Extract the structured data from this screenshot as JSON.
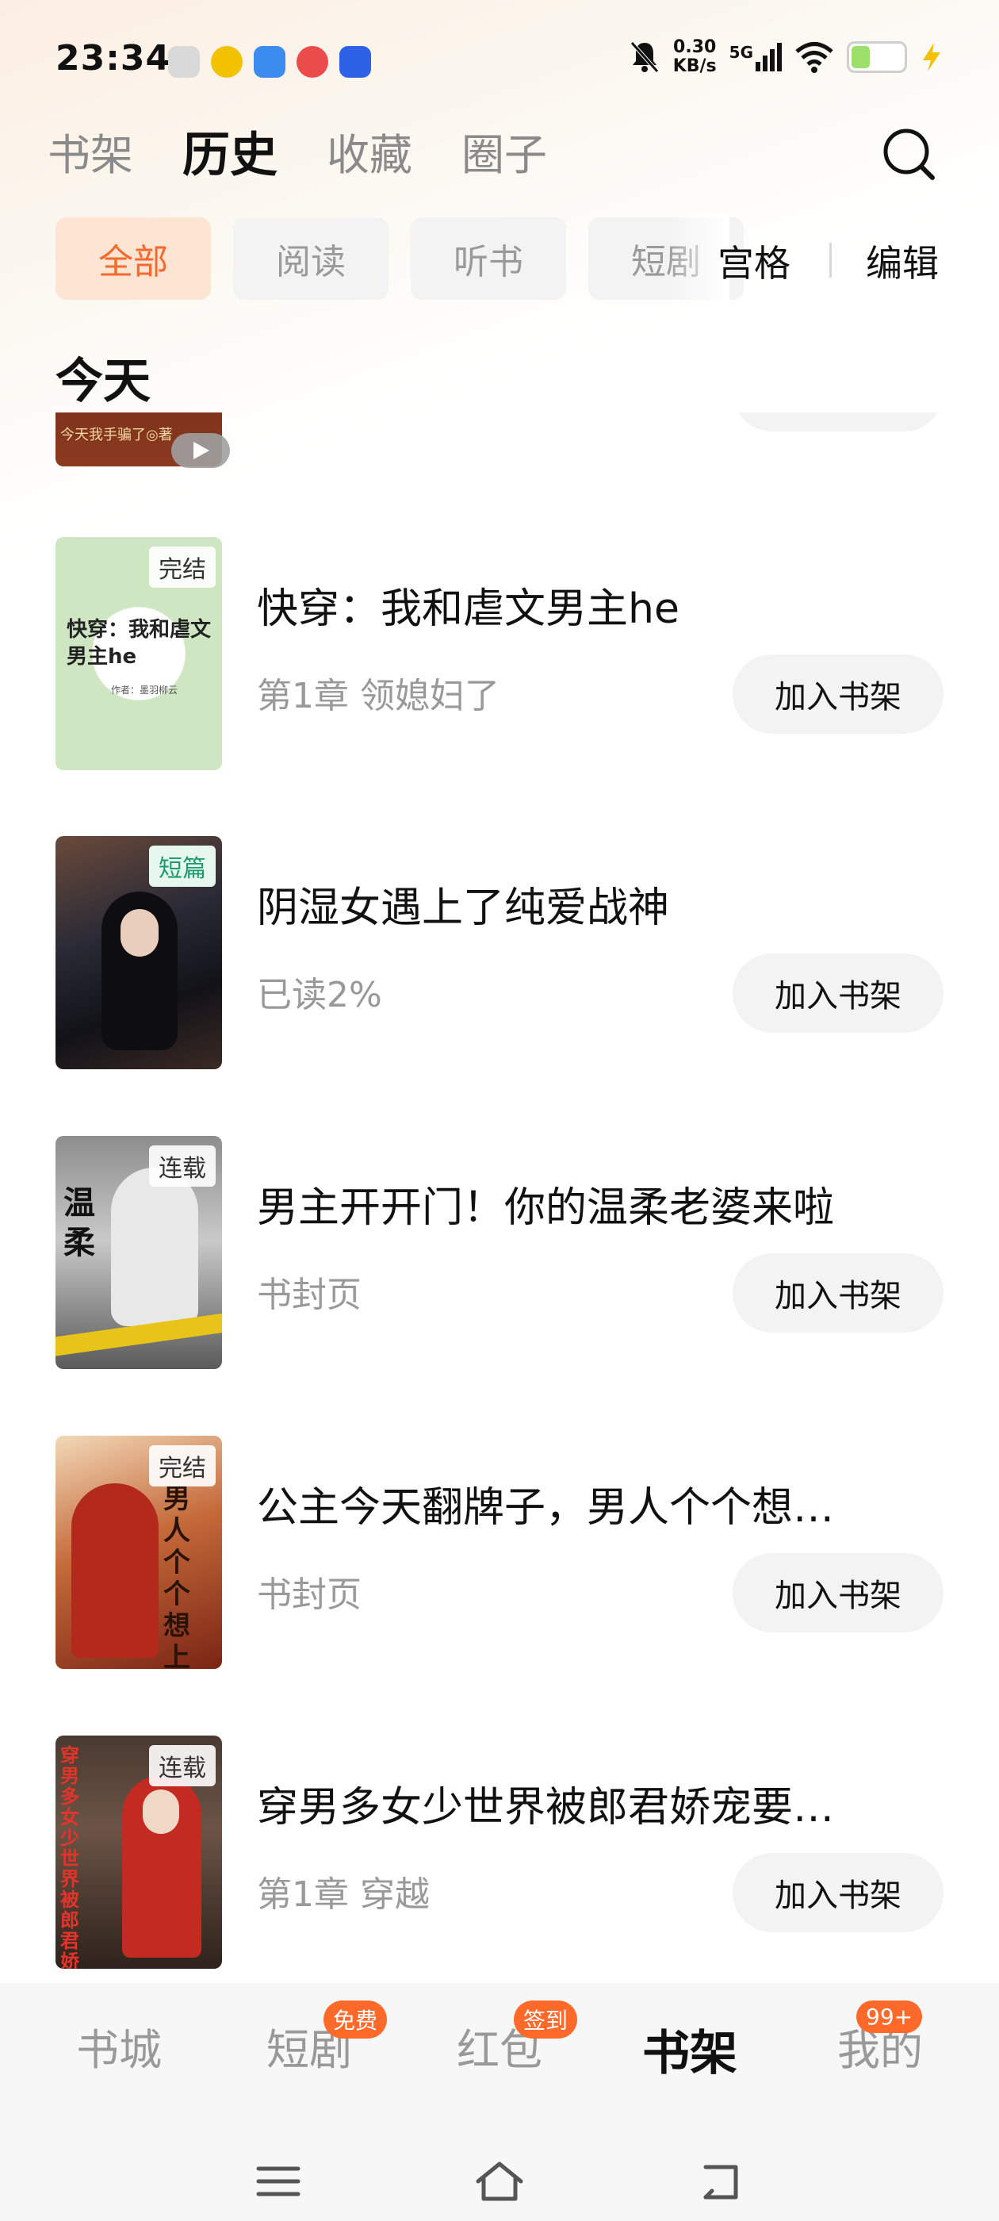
{
  "status": {
    "time": "23:34",
    "net_speed_value": "0.30",
    "net_speed_unit": "KB/s",
    "network": "5G",
    "battery_level": 0.38
  },
  "top_tabs": [
    {
      "label": "书架",
      "active": false
    },
    {
      "label": "历史",
      "active": true
    },
    {
      "label": "收藏",
      "active": false
    },
    {
      "label": "圈子",
      "active": false
    }
  ],
  "filters": [
    {
      "label": "全部",
      "active": true
    },
    {
      "label": "阅读",
      "active": false
    },
    {
      "label": "听书",
      "active": false
    },
    {
      "label": "短剧",
      "active": false
    }
  ],
  "toolbar": {
    "view_mode_label": "宫格",
    "edit_label": "编辑"
  },
  "section_title": "今天",
  "partial_item": {
    "cover_text": "今天我手骗了◎著"
  },
  "books": [
    {
      "title": "快穿：我和虐文男主he",
      "subtitle": "第1章 领媳妇了",
      "badge": "完结",
      "cover_title": "快穿：我和虐文男主he",
      "cover_author": "作者：墨羽柳云",
      "action": "加入书架"
    },
    {
      "title": "阴湿女遇上了纯爱战神",
      "subtitle": "已读2%",
      "badge": "短篇",
      "action": "加入书架"
    },
    {
      "title": "男主开开门！你的温柔老婆来啦",
      "subtitle": "书封页",
      "badge": "连载",
      "cover_title": "温柔",
      "action": "加入书架"
    },
    {
      "title": "公主今天翻牌子，男人个个想…",
      "subtitle": "书封页",
      "badge": "完结",
      "cover_title": "男人个个想上位",
      "action": "加入书架"
    },
    {
      "title": "穿男多女少世界被郎君娇宠要…",
      "subtitle": "第1章 穿越",
      "badge": "连载",
      "cover_title": "穿男多女少世界被郎君娇宠躺平",
      "action": "加入书架"
    }
  ],
  "bottom_nav": [
    {
      "label": "书城",
      "badge": null,
      "active": false
    },
    {
      "label": "短剧",
      "badge": "免费",
      "active": false
    },
    {
      "label": "红包",
      "badge": "签到",
      "active": false
    },
    {
      "label": "书架",
      "badge": null,
      "active": true
    },
    {
      "label": "我的",
      "badge": "99+",
      "active": false
    }
  ],
  "colors": {
    "accent": "#f26a2e",
    "accent_bg": "#fde4d3",
    "badge": "#ff6a2b"
  }
}
